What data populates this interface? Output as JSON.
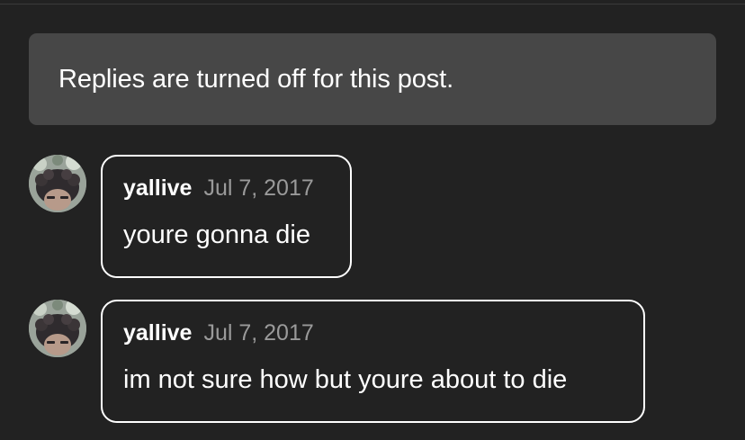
{
  "notice": {
    "text": "Replies are turned off for this post."
  },
  "replies": [
    {
      "username": "yallive",
      "date": "Jul 7, 2017",
      "message": "youre gonna die",
      "avatar": "user-avatar"
    },
    {
      "username": "yallive",
      "date": "Jul 7, 2017",
      "message": "im not sure how but youre about to die",
      "avatar": "user-avatar"
    }
  ],
  "colors": {
    "background": "#222222",
    "notice_bg": "#474747",
    "text": "#ffffff",
    "date": "#9a9a9a",
    "bubble_border": "#ffffff"
  }
}
